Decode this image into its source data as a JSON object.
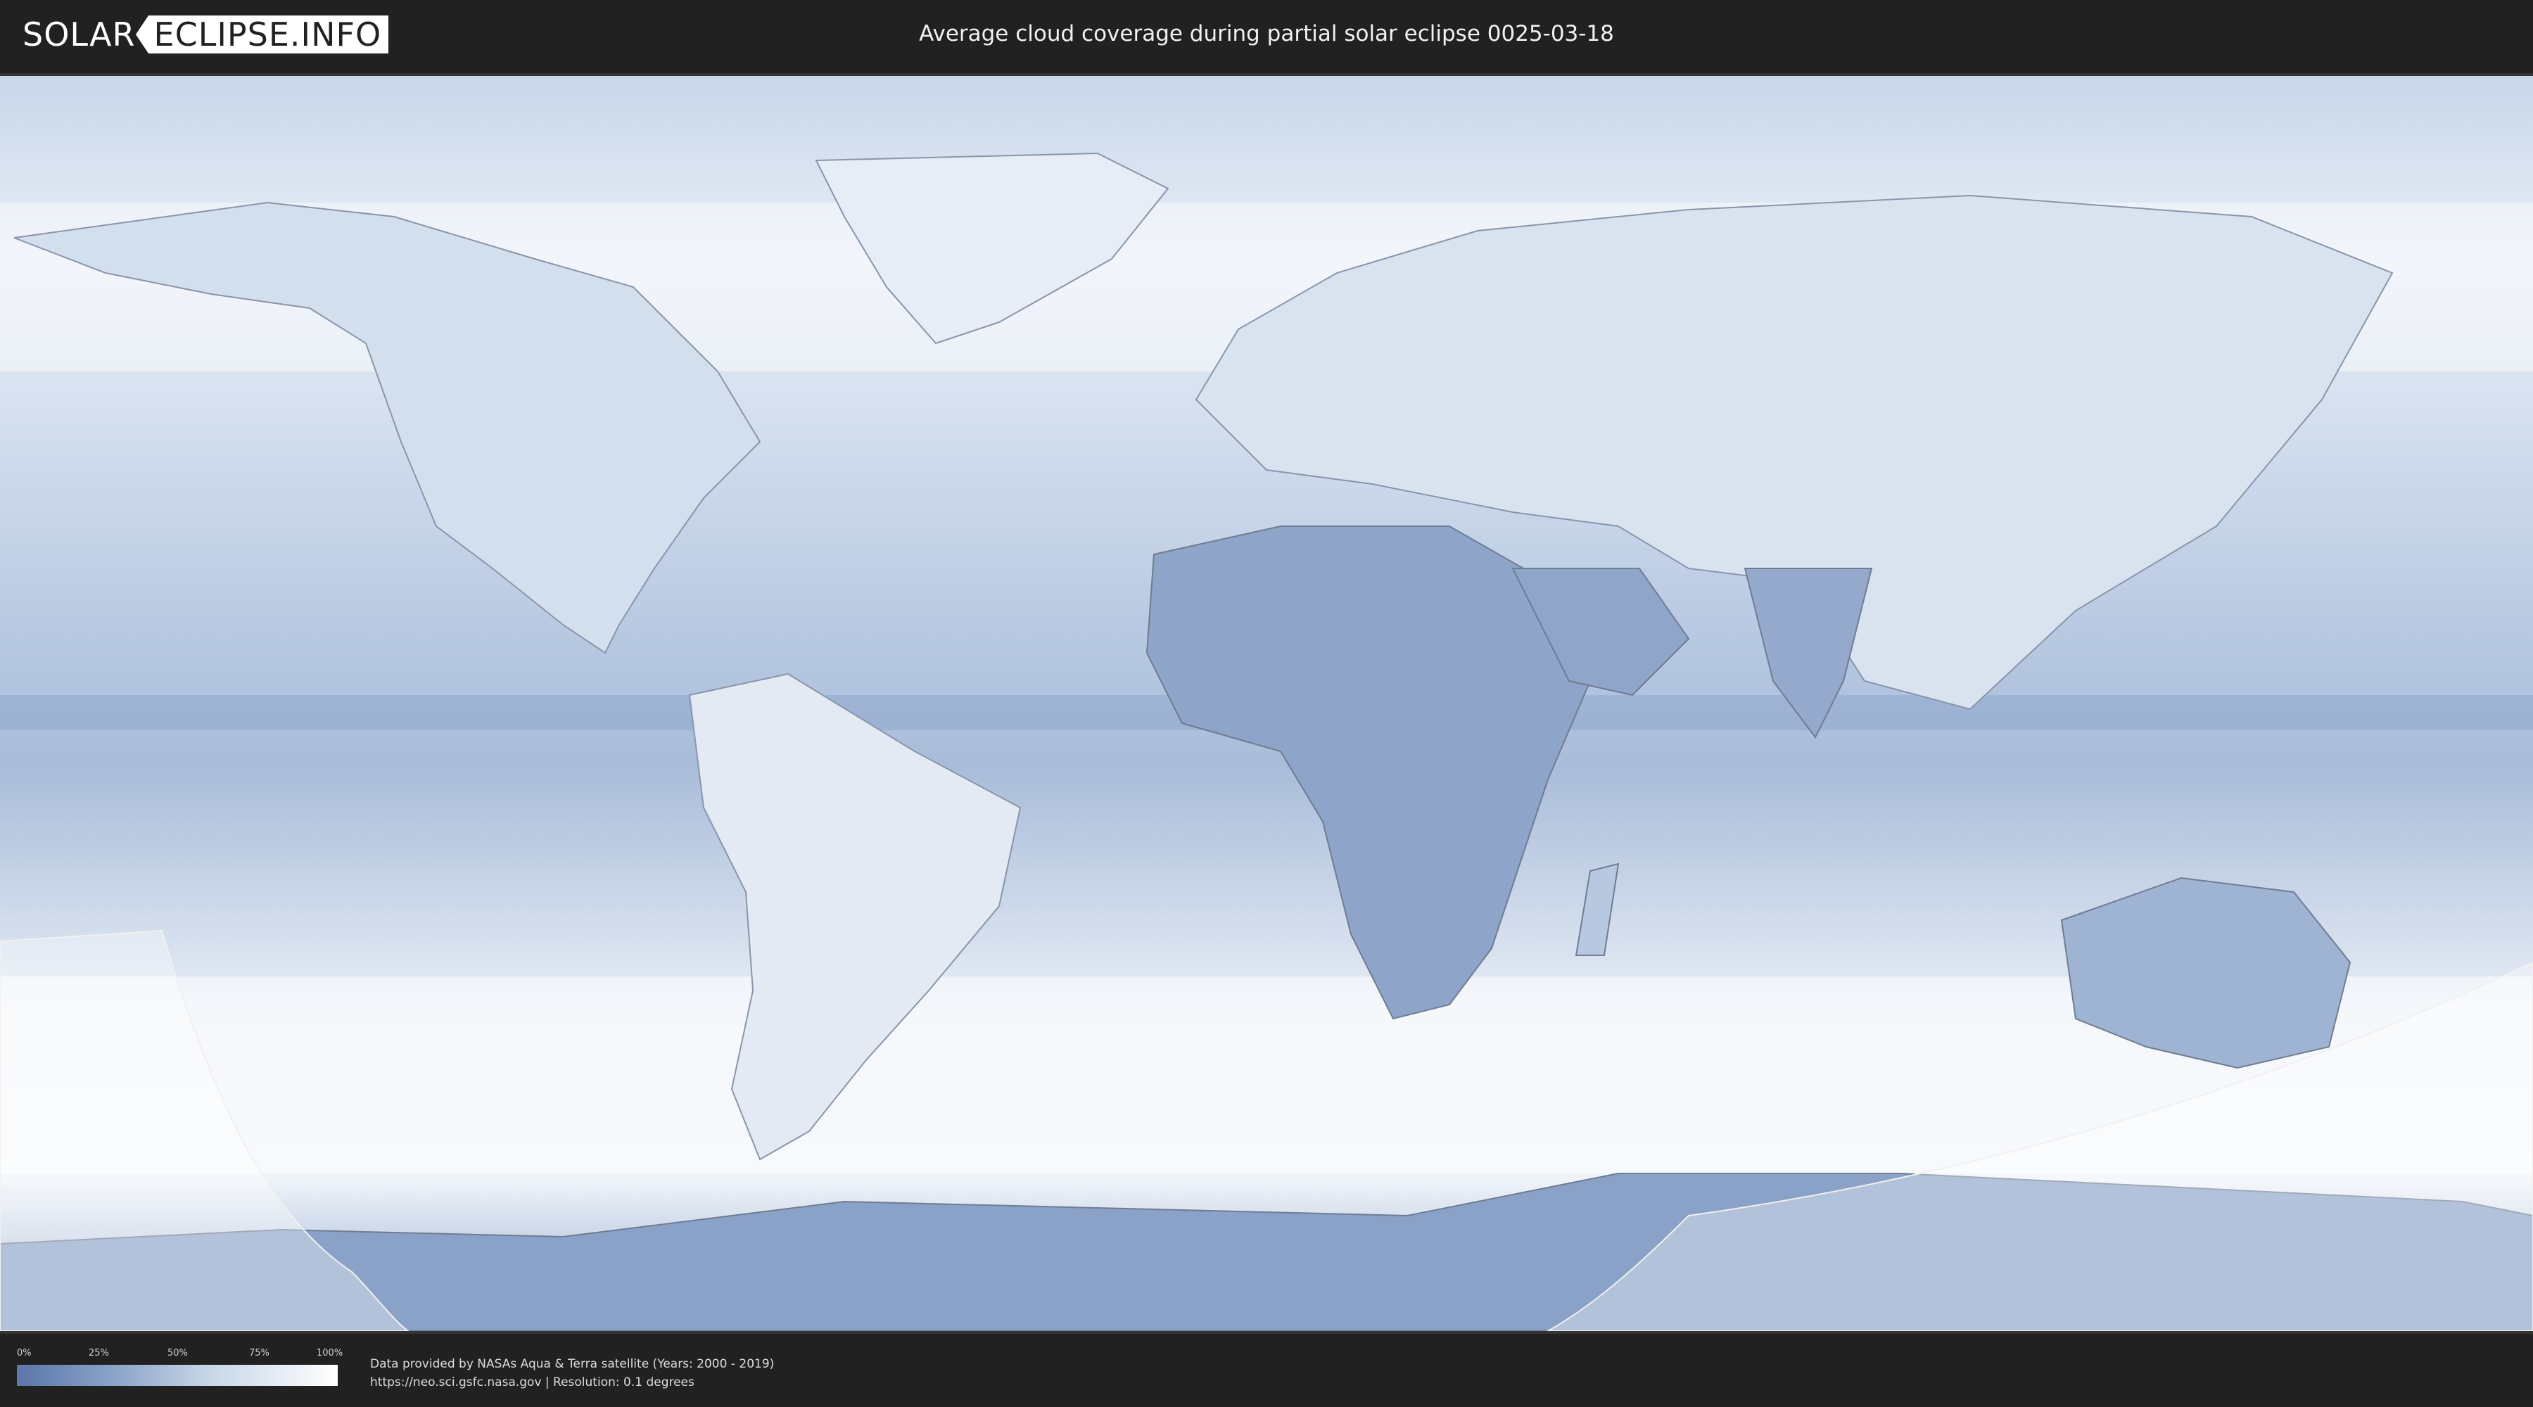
{
  "header": {
    "logo_left": "SOLAR",
    "logo_right": "ECLIPSE.INFO",
    "title": "Average cloud coverage during partial solar eclipse 0025-03-18"
  },
  "map": {
    "style": "equirectangular world cloud-coverage map",
    "colors": {
      "clear": "#5b76a8",
      "mid": "#a9bcd9",
      "cloudy": "#f4f7fb",
      "eclipse_zone_overlay": "#ffffff"
    },
    "eclipse_zones": [
      "south-west corner zone",
      "south-east corner zone"
    ]
  },
  "legend": {
    "ticks": [
      "0%",
      "25%",
      "50%",
      "75%",
      "100%"
    ],
    "gradient_from": "#5b76a8",
    "gradient_to": "#ffffff"
  },
  "credits": {
    "line1": "Data provided by NASAs Aqua & Terra satellite (Years: 2000 - 2019)",
    "line2": "https://neo.sci.gsfc.nasa.gov | Resolution: 0.1 degrees"
  }
}
